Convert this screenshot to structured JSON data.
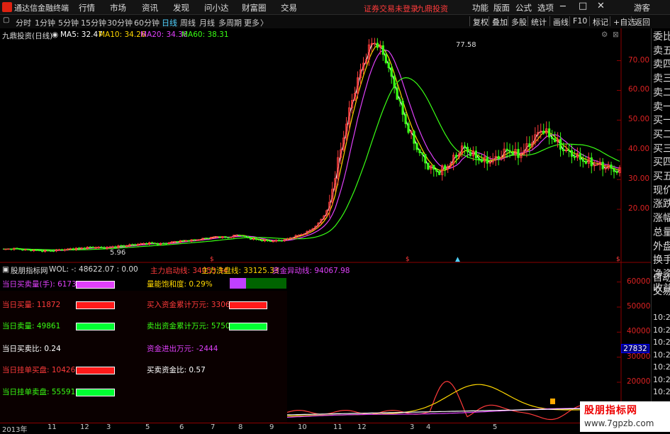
{
  "app": {
    "title": "通达信金融终端",
    "menus": [
      "行情",
      "市场",
      "资讯",
      "发现",
      "问小达",
      "财富圈",
      "交易"
    ],
    "status_notice": "证券交易未登录",
    "stock_link": "九鼎投资",
    "right_menus": [
      "功能",
      "版面",
      "公式",
      "选项"
    ],
    "user": "游客"
  },
  "toolbar": {
    "periods": [
      "分时",
      "1分钟",
      "5分钟",
      "15分钟",
      "30分钟",
      "60分钟",
      "日线",
      "周线",
      "月线",
      "多周期",
      "更多"
    ],
    "active_period": "日线",
    "more_arrow": "〉",
    "right_buttons": [
      "复权",
      "叠加",
      "多股",
      "统计",
      "画线",
      "F10",
      "标记",
      "+自选",
      "返回"
    ]
  },
  "main_chart": {
    "stock_title": "九鼎投资(日线)",
    "ma_labels": [
      {
        "text": "MA5: 32.47",
        "color": "#ffffff"
      },
      {
        "text": "MA10: 34.26",
        "color": "#ffd700"
      },
      {
        "text": "MA20: 34.36",
        "color": "#e040fb"
      },
      {
        "text": "MA60: 38.31",
        "color": "#39ff14"
      }
    ],
    "high_label": "77.58",
    "low_label": "5.96",
    "tool_icons": [
      "⚙",
      "⊠"
    ],
    "markers": [
      "$",
      "$",
      "$"
    ]
  },
  "chart_data": [
    {
      "type": "candlestick",
      "title": "九鼎投资(日线)",
      "ylim": [
        5,
        78
      ],
      "yticks": [
        20.0,
        30.0,
        40.0,
        50.0,
        60.0,
        70.0
      ],
      "ytick_labels": [
        "20.00",
        "30.00",
        "40.00",
        "50.00",
        "60.00",
        "70.00"
      ],
      "x_labels": [
        "2013年",
        "11",
        "12",
        "3",
        "5",
        "6",
        "7",
        "8",
        "9",
        "10",
        "11",
        "12",
        "3",
        "4",
        "5"
      ],
      "high": 77.58,
      "low": 5.96,
      "series": [
        {
          "name": "MA5",
          "color": "#ffffff",
          "last": 32.47
        },
        {
          "name": "MA10",
          "color": "#ffd700",
          "last": 34.26
        },
        {
          "name": "MA20",
          "color": "#e040fb",
          "last": 34.36
        },
        {
          "name": "MA60",
          "color": "#39ff14",
          "last": 38.31
        }
      ],
      "price_path": [
        6.5,
        6.8,
        6.4,
        6.2,
        6.0,
        6.3,
        6.6,
        6.9,
        7.2,
        7.0,
        7.4,
        7.8,
        8.2,
        8.6,
        8.3,
        8.9,
        9.4,
        9.6,
        10.2,
        10.8,
        10.5,
        11.5,
        10.2,
        9.6,
        9.3,
        9.6,
        10.8,
        12.0,
        14.5,
        20.0,
        38.0,
        55.0,
        68.0,
        77.0,
        72.0,
        60.0,
        48.0,
        40.0,
        34.0,
        32.5,
        36.0,
        41.0,
        38.0,
        36.0,
        37.0,
        40.0,
        38.0,
        42.0,
        47.0,
        44.0,
        40.0,
        38.0,
        36.0,
        35.0,
        34.0,
        32.5
      ]
    },
    {
      "type": "line",
      "title": "股朋指标网",
      "ylim": [
        5000,
        65000
      ],
      "yticks": [
        10000,
        20000,
        30000,
        40000,
        50000,
        60000
      ],
      "ytick_labels": [
        "10000",
        "20000",
        "30000",
        "40000",
        "50000",
        "60000"
      ],
      "current_value_label": "27832",
      "header": [
        {
          "text": "股朋指标网",
          "color": "#dddddd"
        },
        {
          "text": "WOL: -: 48622.07 : 0.00",
          "color": "#dddddd"
        },
        {
          "text": "主力启动线: 34053.34",
          "color": "#ff3b3b"
        },
        {
          "text": "主力洗盘线: 33125.33",
          "color": "#ffd700"
        },
        {
          "text": "资金异动线: 94067.98",
          "color": "#e040fb"
        }
      ]
    }
  ],
  "indicators": {
    "left": [
      {
        "label": "当日买卖量(手): 61733",
        "color": "#e040fb",
        "bar": "#e040fb"
      },
      {
        "label": "当日买量: 11872",
        "color": "#ff3b3b",
        "bar": "#ff1a1a"
      },
      {
        "label": "当日卖量: 49861",
        "color": "#39ff14",
        "bar": "#00ff33"
      },
      {
        "label": "当日买卖比: 0.24",
        "color": "#ffffff",
        "bar": ""
      },
      {
        "label": "当日挂单买盘: 104261",
        "color": "#ff3b3b",
        "bar": "#ff1a1a"
      },
      {
        "label": "当日挂单卖盘: 55591",
        "color": "#39ff14",
        "bar": "#00ff33"
      }
    ],
    "right": [
      {
        "label": "量能饱和度: 0.29%",
        "color": "#ffd700",
        "bar": "split"
      },
      {
        "label": "买入资金累计万元: 3306",
        "color": "#ff3b3b",
        "bar": "#ff1a1a"
      },
      {
        "label": "卖出资金累计万元: 5750",
        "color": "#39ff14",
        "bar": "#00ff33"
      },
      {
        "label": "资金进出万元: -2444",
        "color": "#e040fb",
        "bar": ""
      },
      {
        "label": "买卖资金比: 0.57",
        "color": "#ffffff",
        "bar": ""
      }
    ]
  },
  "sidebar": {
    "items": [
      "委比",
      "卖五",
      "卖四",
      "卖三",
      "卖二",
      "卖一",
      "买一",
      "买二",
      "买三",
      "买四",
      "买五",
      "现价",
      "涨跌",
      "涨幅",
      "总量",
      "外盘",
      "换手",
      "净资",
      "收益"
    ],
    "auto_trade": [
      "自动",
      "交易"
    ],
    "times": [
      "10:2",
      "10:2",
      "10:2",
      "10:2",
      "10:2",
      "10:2",
      "10:2",
      "10:2"
    ]
  },
  "watermark": {
    "title": "股朋指标网",
    "url": "www.7gpzb.com"
  },
  "colors": {
    "background": "#000000",
    "up": "#ff3b3b",
    "down": "#39ff14",
    "axis": "#d22222"
  }
}
